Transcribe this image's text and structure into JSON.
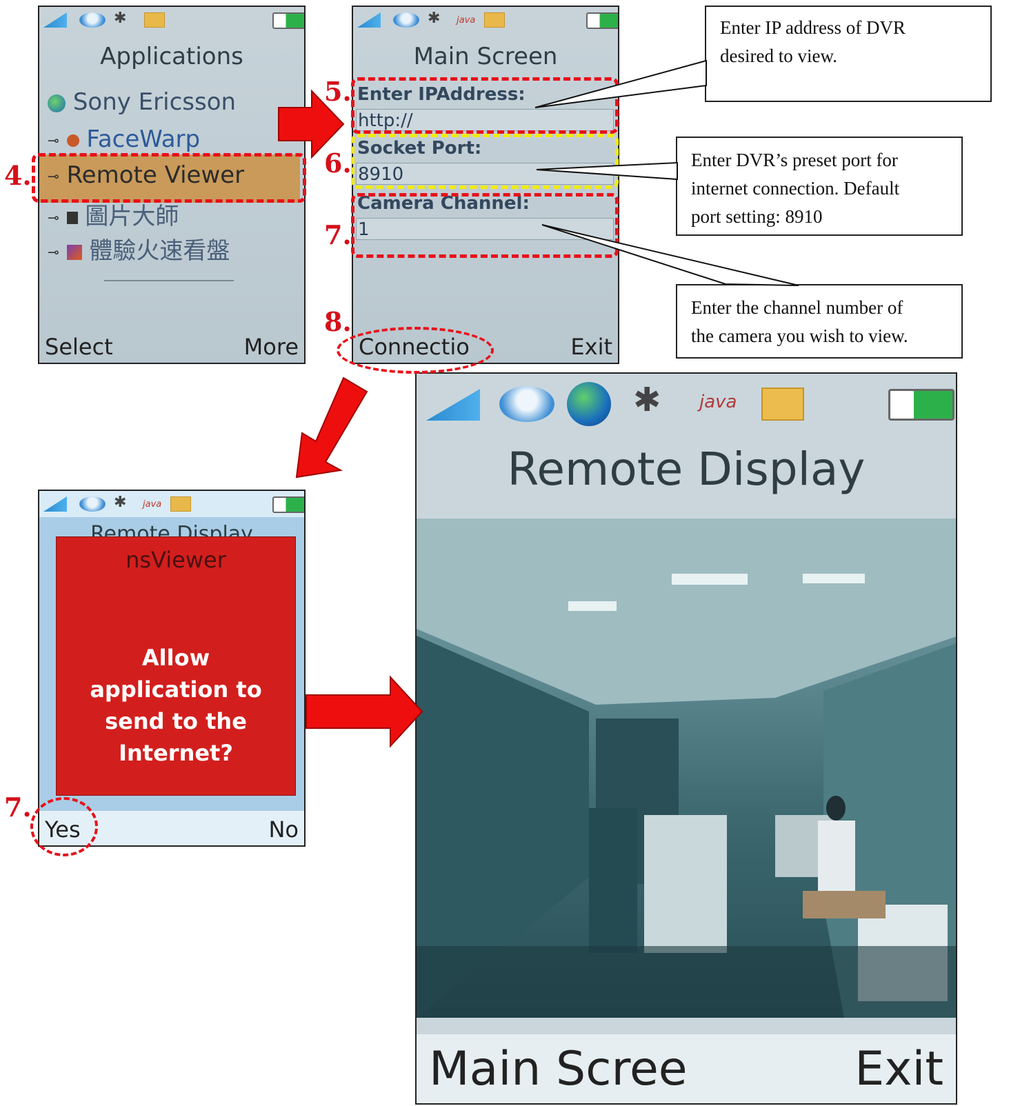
{
  "colors": {
    "accent_red": "#e8111a",
    "highlight_yellow": "#f2ea10",
    "dialog_red": "#d21f1d",
    "selection_orange": "#c99a5a"
  },
  "steps": {
    "s4": "4.",
    "s5": "5.",
    "s6": "6.",
    "s7a": "7.",
    "s8": "8.",
    "s7b": "7."
  },
  "screen1": {
    "title": "Applications",
    "items": [
      {
        "label": "Sony Ericsson",
        "icon": "globe-icon"
      },
      {
        "label": "FaceWarp",
        "icon": "key-icon"
      },
      {
        "label": "Remote Viewer",
        "icon": "key-icon"
      },
      {
        "label": "圖片大師",
        "icon": "key-icon"
      },
      {
        "label": "體驗火速看盤",
        "icon": "key-icon"
      }
    ],
    "softkey_left": "Select",
    "softkey_right": "More"
  },
  "screen2": {
    "title": "Main Screen",
    "ip_label": "Enter IPAddress:",
    "ip_value": "http://",
    "port_label": "Socket Port:",
    "port_value": "8910",
    "channel_label": "Camera Channel:",
    "channel_value": "1",
    "softkey_left": "Connectio",
    "softkey_right": "Exit"
  },
  "screen3": {
    "behind_title": "Remote Display",
    "dialog_title": "nsViewer",
    "dialog_message": "Allow application to send to the Internet?",
    "softkey_left": "Yes",
    "softkey_right": "No"
  },
  "screen4": {
    "title": "Remote Display",
    "softkey_left": "Main Scree",
    "softkey_right": "Exit"
  },
  "callouts": {
    "ip": [
      "Enter IP address of DVR",
      "desired to view."
    ],
    "port": [
      "Enter DVR’s preset port for",
      "internet connection. Default",
      "port setting: 8910"
    ],
    "channel": [
      "Enter the channel number of",
      "the camera you wish to view."
    ]
  }
}
